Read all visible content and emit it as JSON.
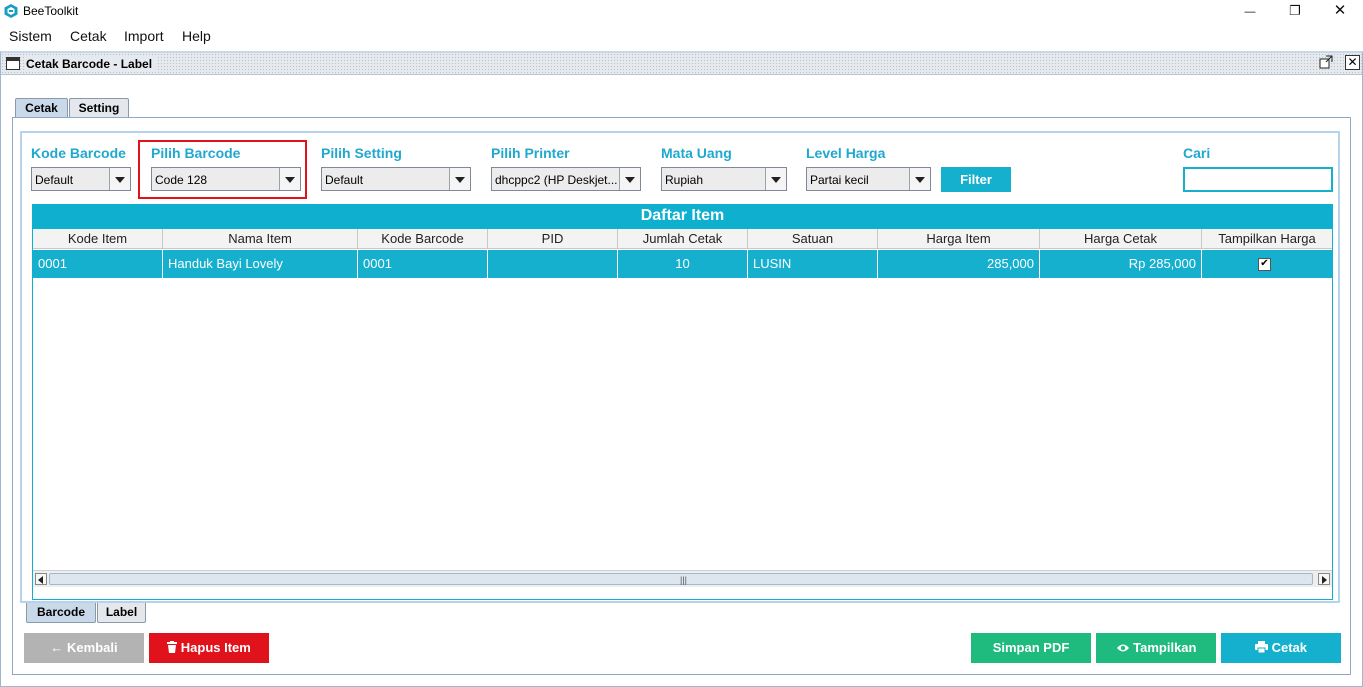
{
  "app": {
    "title": "BeeToolkit"
  },
  "window_controls": {
    "minimize": "—",
    "maximize": "❐",
    "close": "✕"
  },
  "menu": [
    "Sistem",
    "Cetak",
    "Import",
    "Help"
  ],
  "internal_frame": {
    "title": "Cetak Barcode - Label"
  },
  "tabs_top": [
    "Cetak",
    "Setting"
  ],
  "filters": {
    "kode_barcode": {
      "label": "Kode Barcode",
      "value": "Default"
    },
    "pilih_barcode": {
      "label": "Pilih Barcode",
      "value": "Code 128"
    },
    "pilih_setting": {
      "label": "Pilih Setting",
      "value": "Default"
    },
    "pilih_printer": {
      "label": "Pilih Printer",
      "value": "dhcppc2 (HP Deskjet..."
    },
    "mata_uang": {
      "label": "Mata Uang",
      "value": "Rupiah"
    },
    "level_harga": {
      "label": "Level Harga",
      "value": "Partai kecil"
    },
    "filter_button": "Filter",
    "cari": {
      "label": "Cari",
      "value": ""
    }
  },
  "table": {
    "title": "Daftar Item",
    "columns": [
      "Kode Item",
      "Nama Item",
      "Kode Barcode",
      "PID",
      "Jumlah Cetak",
      "Satuan",
      "Harga Item",
      "Harga Cetak",
      "Tampilkan Harga"
    ],
    "rows": [
      {
        "kode_item": "0001",
        "nama_item": "Handuk Bayi Lovely",
        "kode_barcode": "0001",
        "pid": "",
        "jumlah_cetak": "10",
        "satuan": "LUSIN",
        "harga_item": "285,000",
        "harga_cetak": "Rp 285,000",
        "tampilkan_harga": true
      }
    ]
  },
  "tabs_bottom": [
    "Barcode",
    "Label"
  ],
  "buttons": {
    "kembali": "Kembali",
    "hapus_item": "Hapus Item",
    "simpan_pdf": "Simpan PDF",
    "tampilkan": "Tampilkan",
    "cetak": "Cetak"
  },
  "colors": {
    "accent": "#16b0cf",
    "delete": "#e0131c",
    "green": "#1fba7e",
    "disabled": "#b3b3b3",
    "highlight": "#e0131c"
  }
}
